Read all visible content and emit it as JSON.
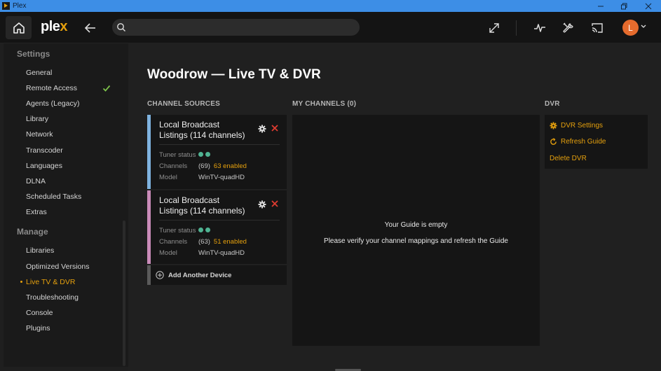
{
  "window": {
    "title": "Plex"
  },
  "topbar": {
    "logo_main": "ple",
    "logo_x": "x",
    "avatar_letter": "L",
    "search_placeholder": ""
  },
  "sidebar": {
    "settings_header": "Settings",
    "settings_items": [
      {
        "label": "General"
      },
      {
        "label": "Remote Access",
        "checked": true
      },
      {
        "label": "Agents (Legacy)"
      },
      {
        "label": "Library"
      },
      {
        "label": "Network"
      },
      {
        "label": "Transcoder"
      },
      {
        "label": "Languages"
      },
      {
        "label": "DLNA"
      },
      {
        "label": "Scheduled Tasks"
      },
      {
        "label": "Extras"
      }
    ],
    "manage_header": "Manage",
    "manage_items": [
      {
        "label": "Libraries"
      },
      {
        "label": "Optimized Versions"
      },
      {
        "label": "Live TV & DVR",
        "active": true
      },
      {
        "label": "Troubleshooting"
      },
      {
        "label": "Console"
      },
      {
        "label": "Plugins"
      }
    ]
  },
  "main": {
    "title": "Woodrow — Live TV & DVR",
    "channel_sources_header": "CHANNEL SOURCES",
    "my_channels_header": "MY CHANNELS (0)",
    "dvr_header": "DVR",
    "sources": [
      {
        "name": "Local Broadcast Listings (114 channels)",
        "accent": "#7fb3e0",
        "tuner_label": "Tuner status",
        "channels_label": "Channels",
        "channels_count": "(69)",
        "channels_enabled": "63 enabled",
        "model_label": "Model",
        "model": "WinTV-quadHD"
      },
      {
        "name": "Local Broadcast Listings (114 channels)",
        "accent": "#c98bb9",
        "tuner_label": "Tuner status",
        "channels_label": "Channels",
        "channels_count": "(63)",
        "channels_enabled": "51 enabled",
        "model_label": "Model",
        "model": "WinTV-quadHD"
      }
    ],
    "add_device_label": "Add Another Device",
    "guide_empty_title": "Your Guide is empty",
    "guide_empty_message": "Please verify your channel mappings and refresh the Guide",
    "dvr_actions": {
      "settings": "DVR Settings",
      "refresh": "Refresh Guide",
      "delete": "Delete DVR"
    }
  },
  "colors": {
    "accent": "#e5a00d",
    "tuner_ok": "#4fb392",
    "close_red": "#e03c31"
  }
}
